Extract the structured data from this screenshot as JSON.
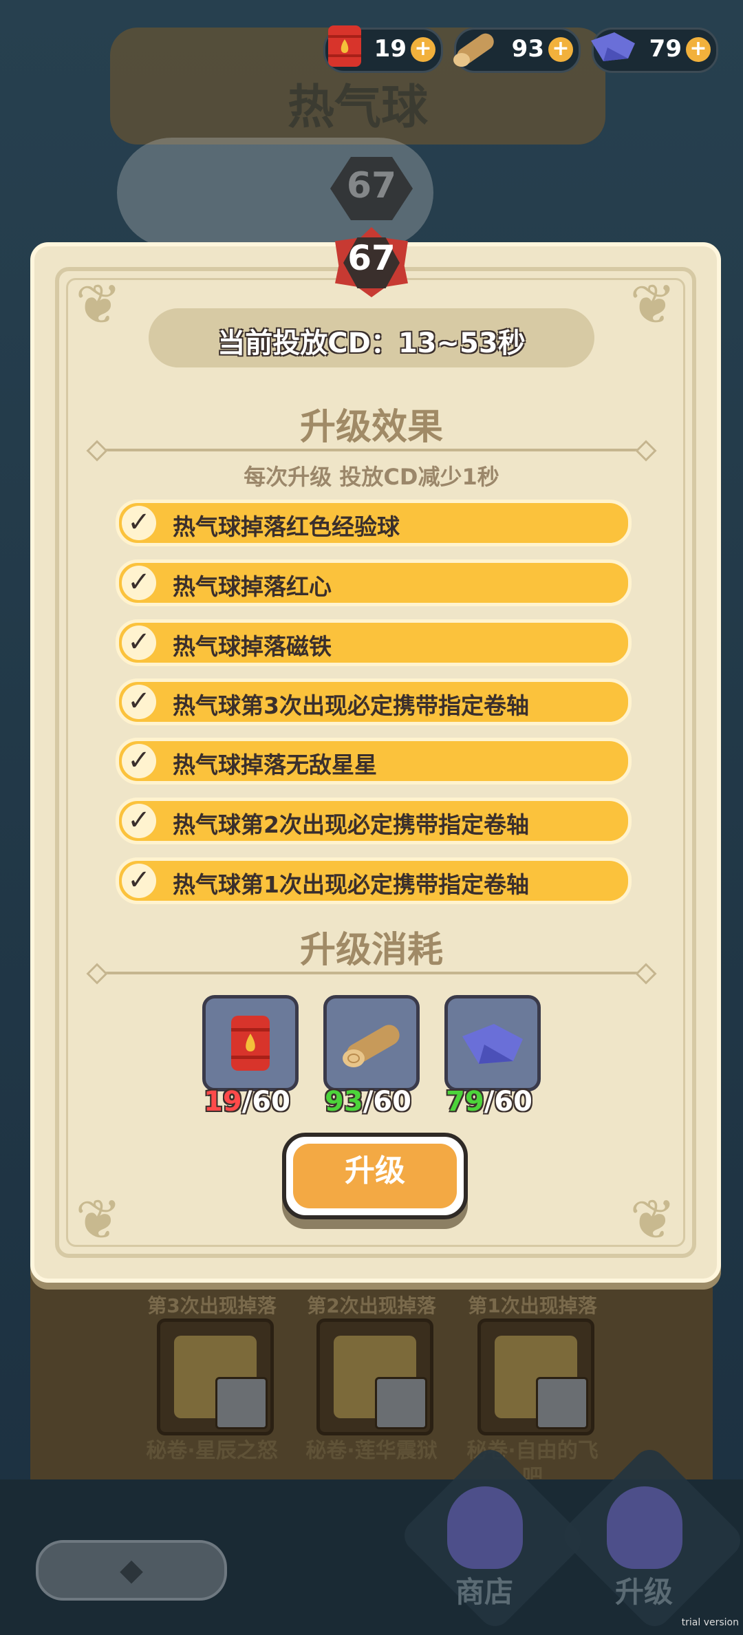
{
  "header": {
    "title": "热气球",
    "bg_level": "67"
  },
  "resources": [
    {
      "name": "fuel-barrel-icon",
      "value": "19",
      "plus": "+"
    },
    {
      "name": "wood-log-icon",
      "value": "93",
      "plus": "+"
    },
    {
      "name": "cloth-icon",
      "value": "79",
      "plus": "+"
    }
  ],
  "dialog": {
    "level": "67",
    "cd_text": "当前投放CD：13~53秒",
    "effects_title": "升级效果",
    "effects_subtitle": "每次升级 投放CD减少1秒",
    "effects": [
      "热气球掉落红色经验球",
      "热气球掉落红心",
      "热气球掉落磁铁",
      "热气球第3次出现必定携带指定卷轴",
      "热气球掉落无敌星星",
      "热气球第2次出现必定携带指定卷轴",
      "热气球第1次出现必定携带指定卷轴"
    ],
    "check_glyph": "✓",
    "cost_title": "升级消耗",
    "costs": [
      {
        "icon": "fuel-barrel-icon",
        "have": "19",
        "need": "/60",
        "enough": false
      },
      {
        "icon": "wood-log-icon",
        "have": "93",
        "need": "/60",
        "enough": true
      },
      {
        "icon": "cloth-icon",
        "have": "79",
        "need": "/60",
        "enough": true
      }
    ],
    "upgrade_label": "升级"
  },
  "drops": [
    {
      "label": "第3次出现掉落",
      "name": "秘卷·星辰之怒"
    },
    {
      "label": "第2次出现掉落",
      "name": "秘卷·莲华震狱"
    },
    {
      "label": "第1次出现掉落",
      "name": "秘卷·自由的飞吧"
    }
  ],
  "nav": {
    "back_glyph": "◆",
    "shop_label": "商店",
    "upgrade_label": "升级"
  },
  "watermark": "trial version",
  "colors": {
    "accent": "#fbc23c",
    "panel": "#efe5c8",
    "insufficient": "#ff4a4a",
    "sufficient": "#4cd43a"
  }
}
